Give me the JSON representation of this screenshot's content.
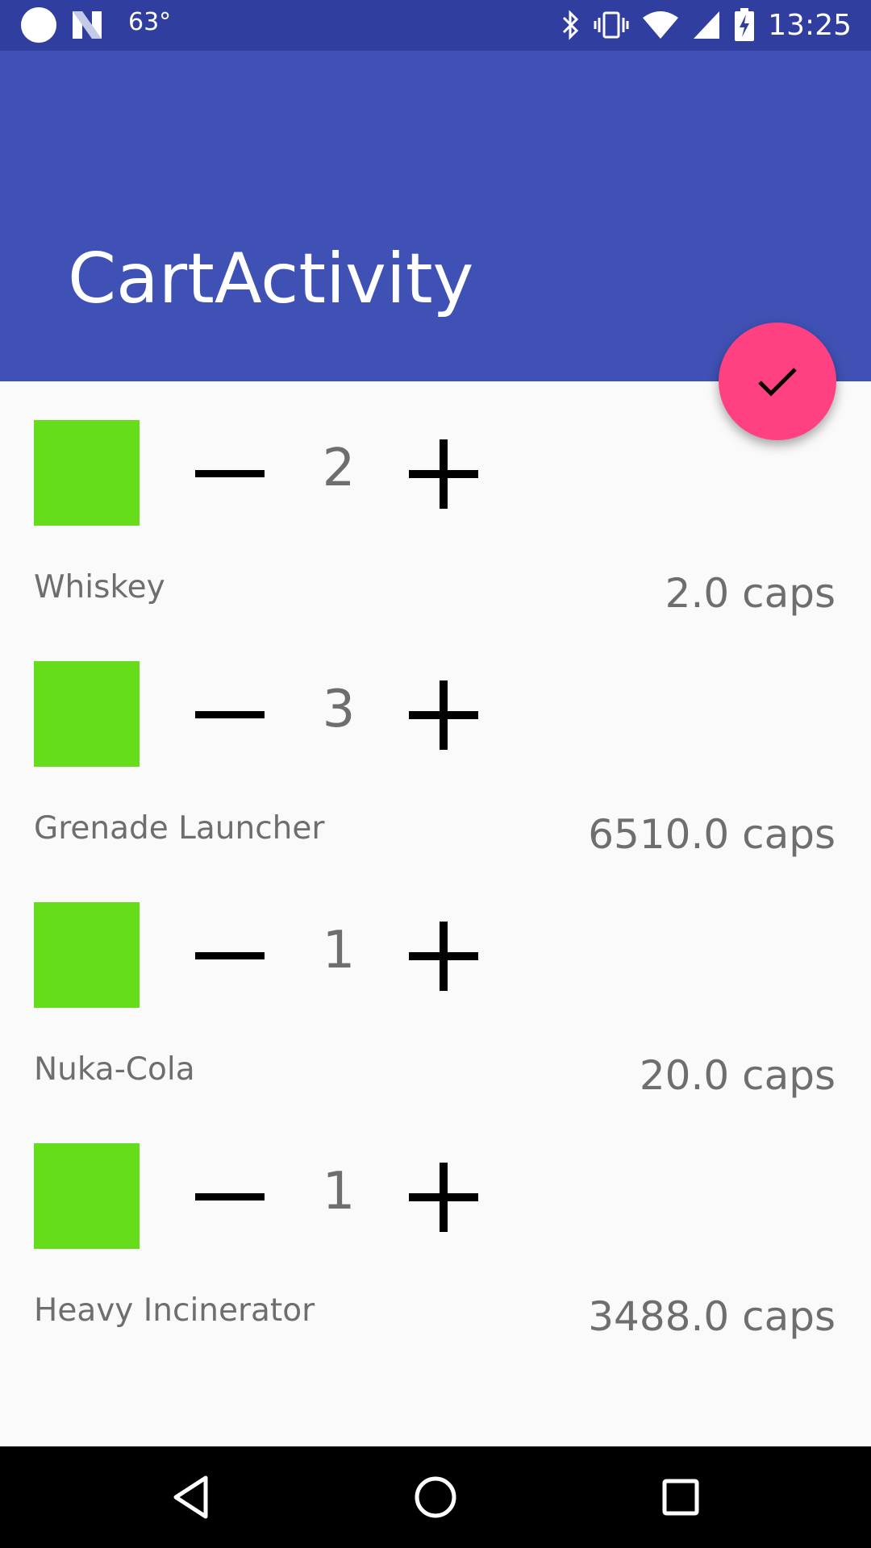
{
  "status_bar": {
    "temperature": "63°",
    "time": "13:25",
    "icons": [
      "notification-dot-icon",
      "n-logo-icon",
      "bluetooth-icon",
      "vibrate-icon",
      "wifi-icon",
      "cell-signal-icon",
      "battery-charging-icon"
    ]
  },
  "app_bar": {
    "title": "CartActivity",
    "color": "#3f51b5",
    "status_color": "#303f9f"
  },
  "fab": {
    "icon": "check-icon",
    "color": "#ff4081"
  },
  "cart": {
    "thumbnail_color": "#66dd1a",
    "items": [
      {
        "name": "Whiskey",
        "quantity": "2",
        "price": "2.0 caps"
      },
      {
        "name": "Grenade Launcher",
        "quantity": "3",
        "price": "6510.0 caps"
      },
      {
        "name": "Nuka-Cola",
        "quantity": "1",
        "price": "20.0 caps"
      },
      {
        "name": "Heavy Incinerator",
        "quantity": "1",
        "price": "3488.0 caps"
      }
    ]
  },
  "nav_bar": {
    "buttons": [
      "back-icon",
      "home-icon",
      "recents-icon"
    ]
  }
}
